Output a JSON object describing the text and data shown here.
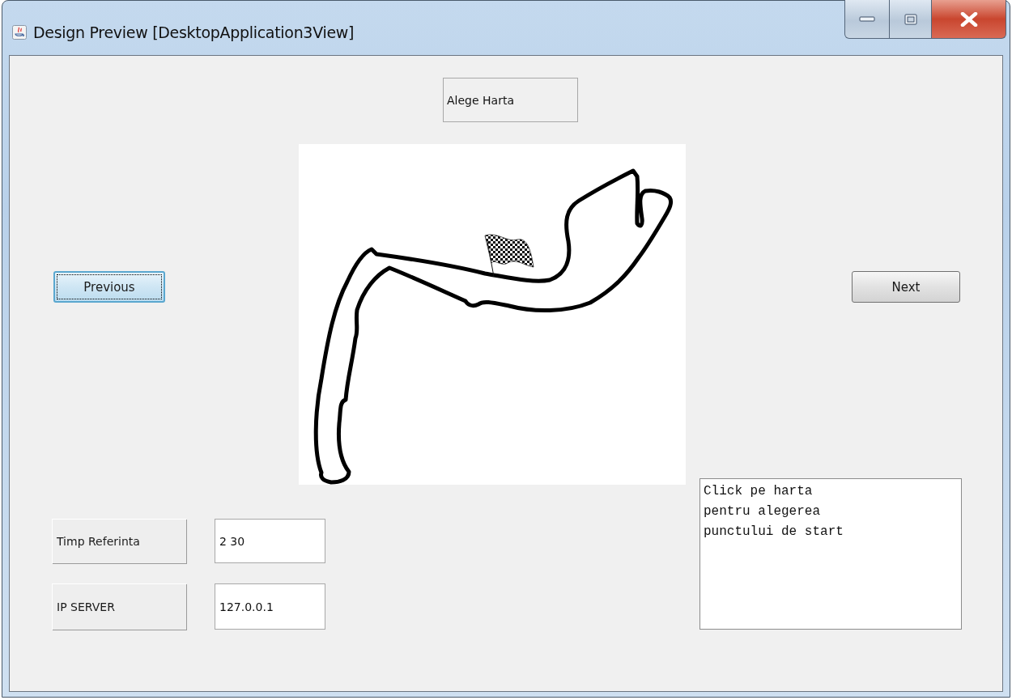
{
  "window": {
    "title": "Design Preview [DesktopApplication3View]"
  },
  "map_title": "Alege Harta",
  "nav_buttons": [
    {
      "label": "Previous",
      "focused": true
    },
    {
      "label": "Next",
      "focused": false
    }
  ],
  "fields": [
    {
      "label": "Timp Referinta",
      "value": "2 30"
    },
    {
      "label": "IP SERVER",
      "value": "127.0.0.1"
    }
  ],
  "info_text": "Click pe harta\npentru alegerea\npunctului de start"
}
